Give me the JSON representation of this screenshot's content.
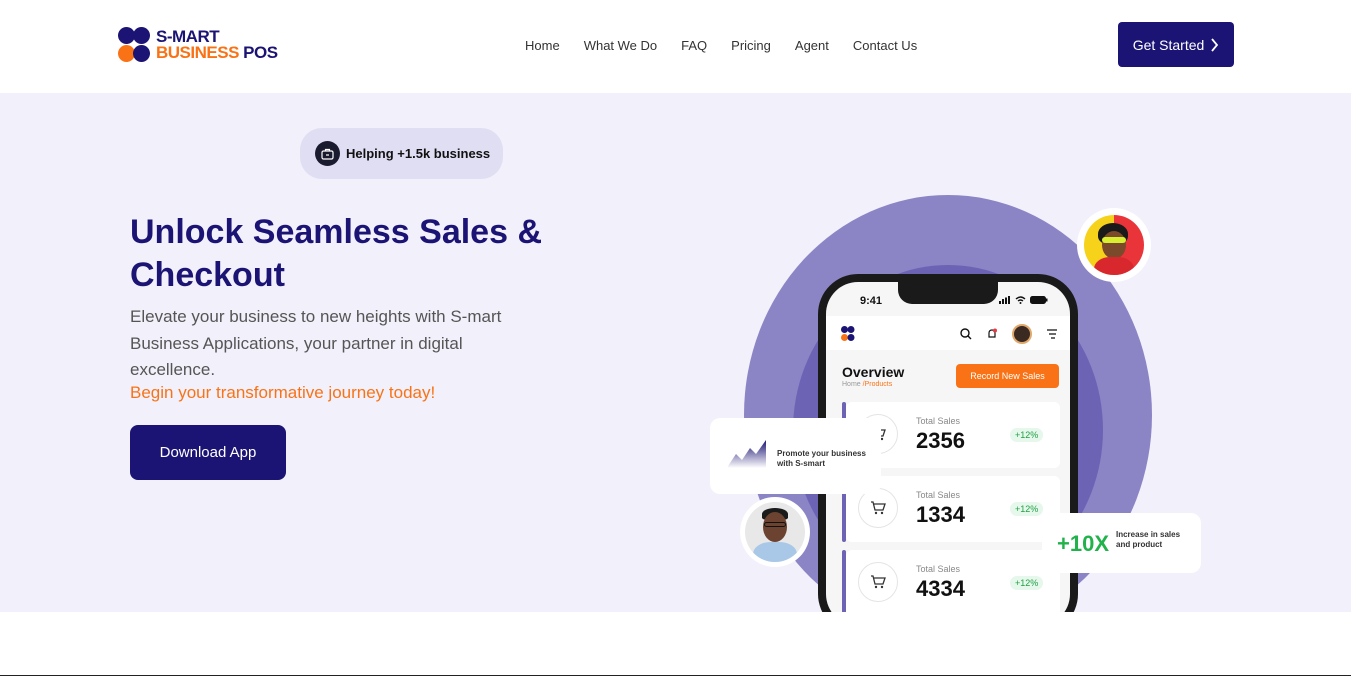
{
  "brand": {
    "line1": "S-MART",
    "line2_accent": "BUSINESS",
    "line2_dark": " POS",
    "colors": {
      "primary": "#1b1474",
      "accent": "#f97316",
      "hero_bg": "#f1f0fb",
      "growth": "#22b24c"
    }
  },
  "nav": {
    "items": [
      "Home",
      "What We Do",
      "FAQ",
      "Pricing",
      "Agent",
      "Contact Us"
    ],
    "cta_label": "Get Started",
    "cta_icon": "chevron-right-icon"
  },
  "hero": {
    "badge": "Helping +1.5k business",
    "badge_icon": "briefcase-icon",
    "title": "Unlock Seamless Sales & Checkout",
    "description": "Elevate your business to new heights with S-mart Business Applications, your partner in digital excellence.",
    "cta_text": "Begin your transformative journey today!",
    "download_label": "Download App"
  },
  "phone": {
    "time": "9:41",
    "page_title": "Overview",
    "breadcrumb_home": "Home",
    "breadcrumb_current": "/Products",
    "record_button": "Record New Sales",
    "stats": [
      {
        "label": "Total Sales",
        "value": "2356",
        "change": "+12%"
      },
      {
        "label": "Total Sales",
        "value": "1334",
        "change": "+12%"
      },
      {
        "label": "Total Sales",
        "value": "4334",
        "change": "+12%"
      }
    ]
  },
  "floating": {
    "promo_text": "Promote your business with S-smart",
    "growth_value": "+10X",
    "growth_text": "Increase in sales and product"
  }
}
